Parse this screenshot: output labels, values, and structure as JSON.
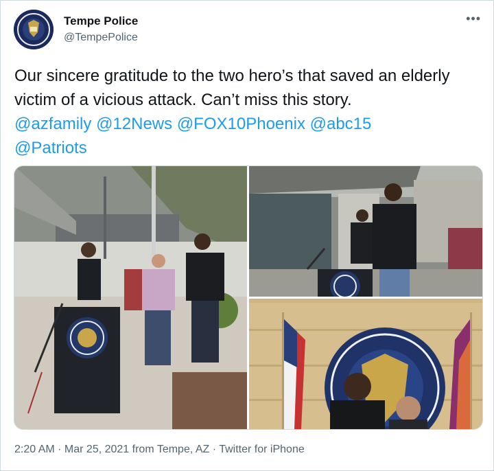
{
  "author": {
    "name": "Tempe Police",
    "handle": "@TempePolice"
  },
  "tweet": {
    "text": "Our sincere gratitude to the two hero’s that saved an elderly victim of a vicious attack. Can’t miss this story.",
    "mentions": [
      "@azfamily",
      "@12News",
      "@FOX10Phoenix",
      "@abc15",
      "@Patriots"
    ]
  },
  "icons": {
    "more": "more-options-icon",
    "avatar": "tempe-police-badge-logo"
  },
  "media": {
    "photos": [
      "press-conference-podium",
      "men-standing-at-podium",
      "men-in-front-of-seal"
    ]
  },
  "meta": {
    "time": "2:20 AM",
    "sep1": " · ",
    "date": "Mar 25, 2021",
    "from": " from ",
    "location": "Tempe, AZ",
    "sep2": " · ",
    "client": "Twitter for iPhone"
  },
  "colors": {
    "link": "#1d9bf0",
    "secondary": "#536471",
    "border": "#cfd9de"
  }
}
